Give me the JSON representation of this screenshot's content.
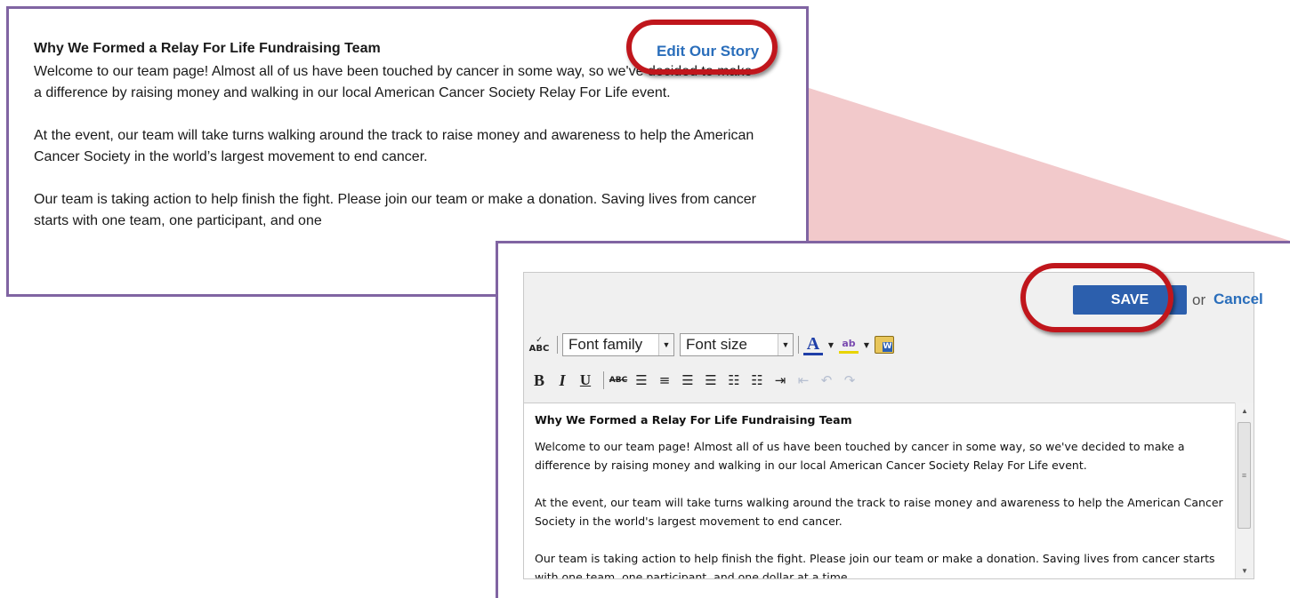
{
  "story": {
    "title": "Why We Formed a Relay For Life Fundraising Team",
    "paragraphs": [
      "Welcome to our team page! Almost all of us have been touched by cancer in some way, so we've decided to make a difference by raising money and walking in our local American Cancer Society Relay For Life event.",
      "At the event, our team will take turns walking around the track to raise money and awareness to help the American Cancer Society in the world’s largest movement to end cancer.",
      "Our team is taking action to help finish the fight. Please join our team or make a donation. Saving lives from cancer starts with one team, one participant, and one"
    ],
    "edit_link": "Edit Our Story"
  },
  "editor": {
    "save_label": "SAVE",
    "or_text": "or",
    "cancel_label": "Cancel",
    "font_family_label": "Font family",
    "font_size_label": "Font size",
    "spellcheck_label": "ABC",
    "content": {
      "heading": "Why We Formed a Relay For Life Fundraising Team",
      "paragraphs": [
        "Welcome to our team page! Almost all of us have been touched by cancer in some way, so we've decided to make a difference by raising money and walking in our local American Cancer Society Relay For Life event.",
        "At the event, our team will take turns walking around the track to raise money and awareness to help the American Cancer Society in the world's largest movement to end cancer.",
        "Our team is taking action to help finish the fight. Please join our team or make a donation. Saving lives from cancer starts with one team, one participant, and one dollar at a time."
      ]
    }
  },
  "icons": {
    "bold": "B",
    "italic": "I",
    "underline": "U",
    "strikethrough": "ABC",
    "align_left": "☰",
    "align_center": "≡",
    "align_right": "☰",
    "justify": "☰",
    "bullet_list": "☷",
    "numbered_list": "☷",
    "indent": "⇥",
    "outdent": "⇤",
    "undo": "↶",
    "redo": "↷",
    "font_color": "A",
    "highlight": "ab",
    "paste_word": "W",
    "dropdown": "▼",
    "scroll_up": "▲",
    "scroll_down": "▼",
    "grip": "≡"
  },
  "colors": {
    "frame_border": "#8064a2",
    "callout_fill": "#f0c0c2",
    "highlight_ring": "#c0161c",
    "save_button": "#2c5fad",
    "link": "#2a6ebb"
  }
}
